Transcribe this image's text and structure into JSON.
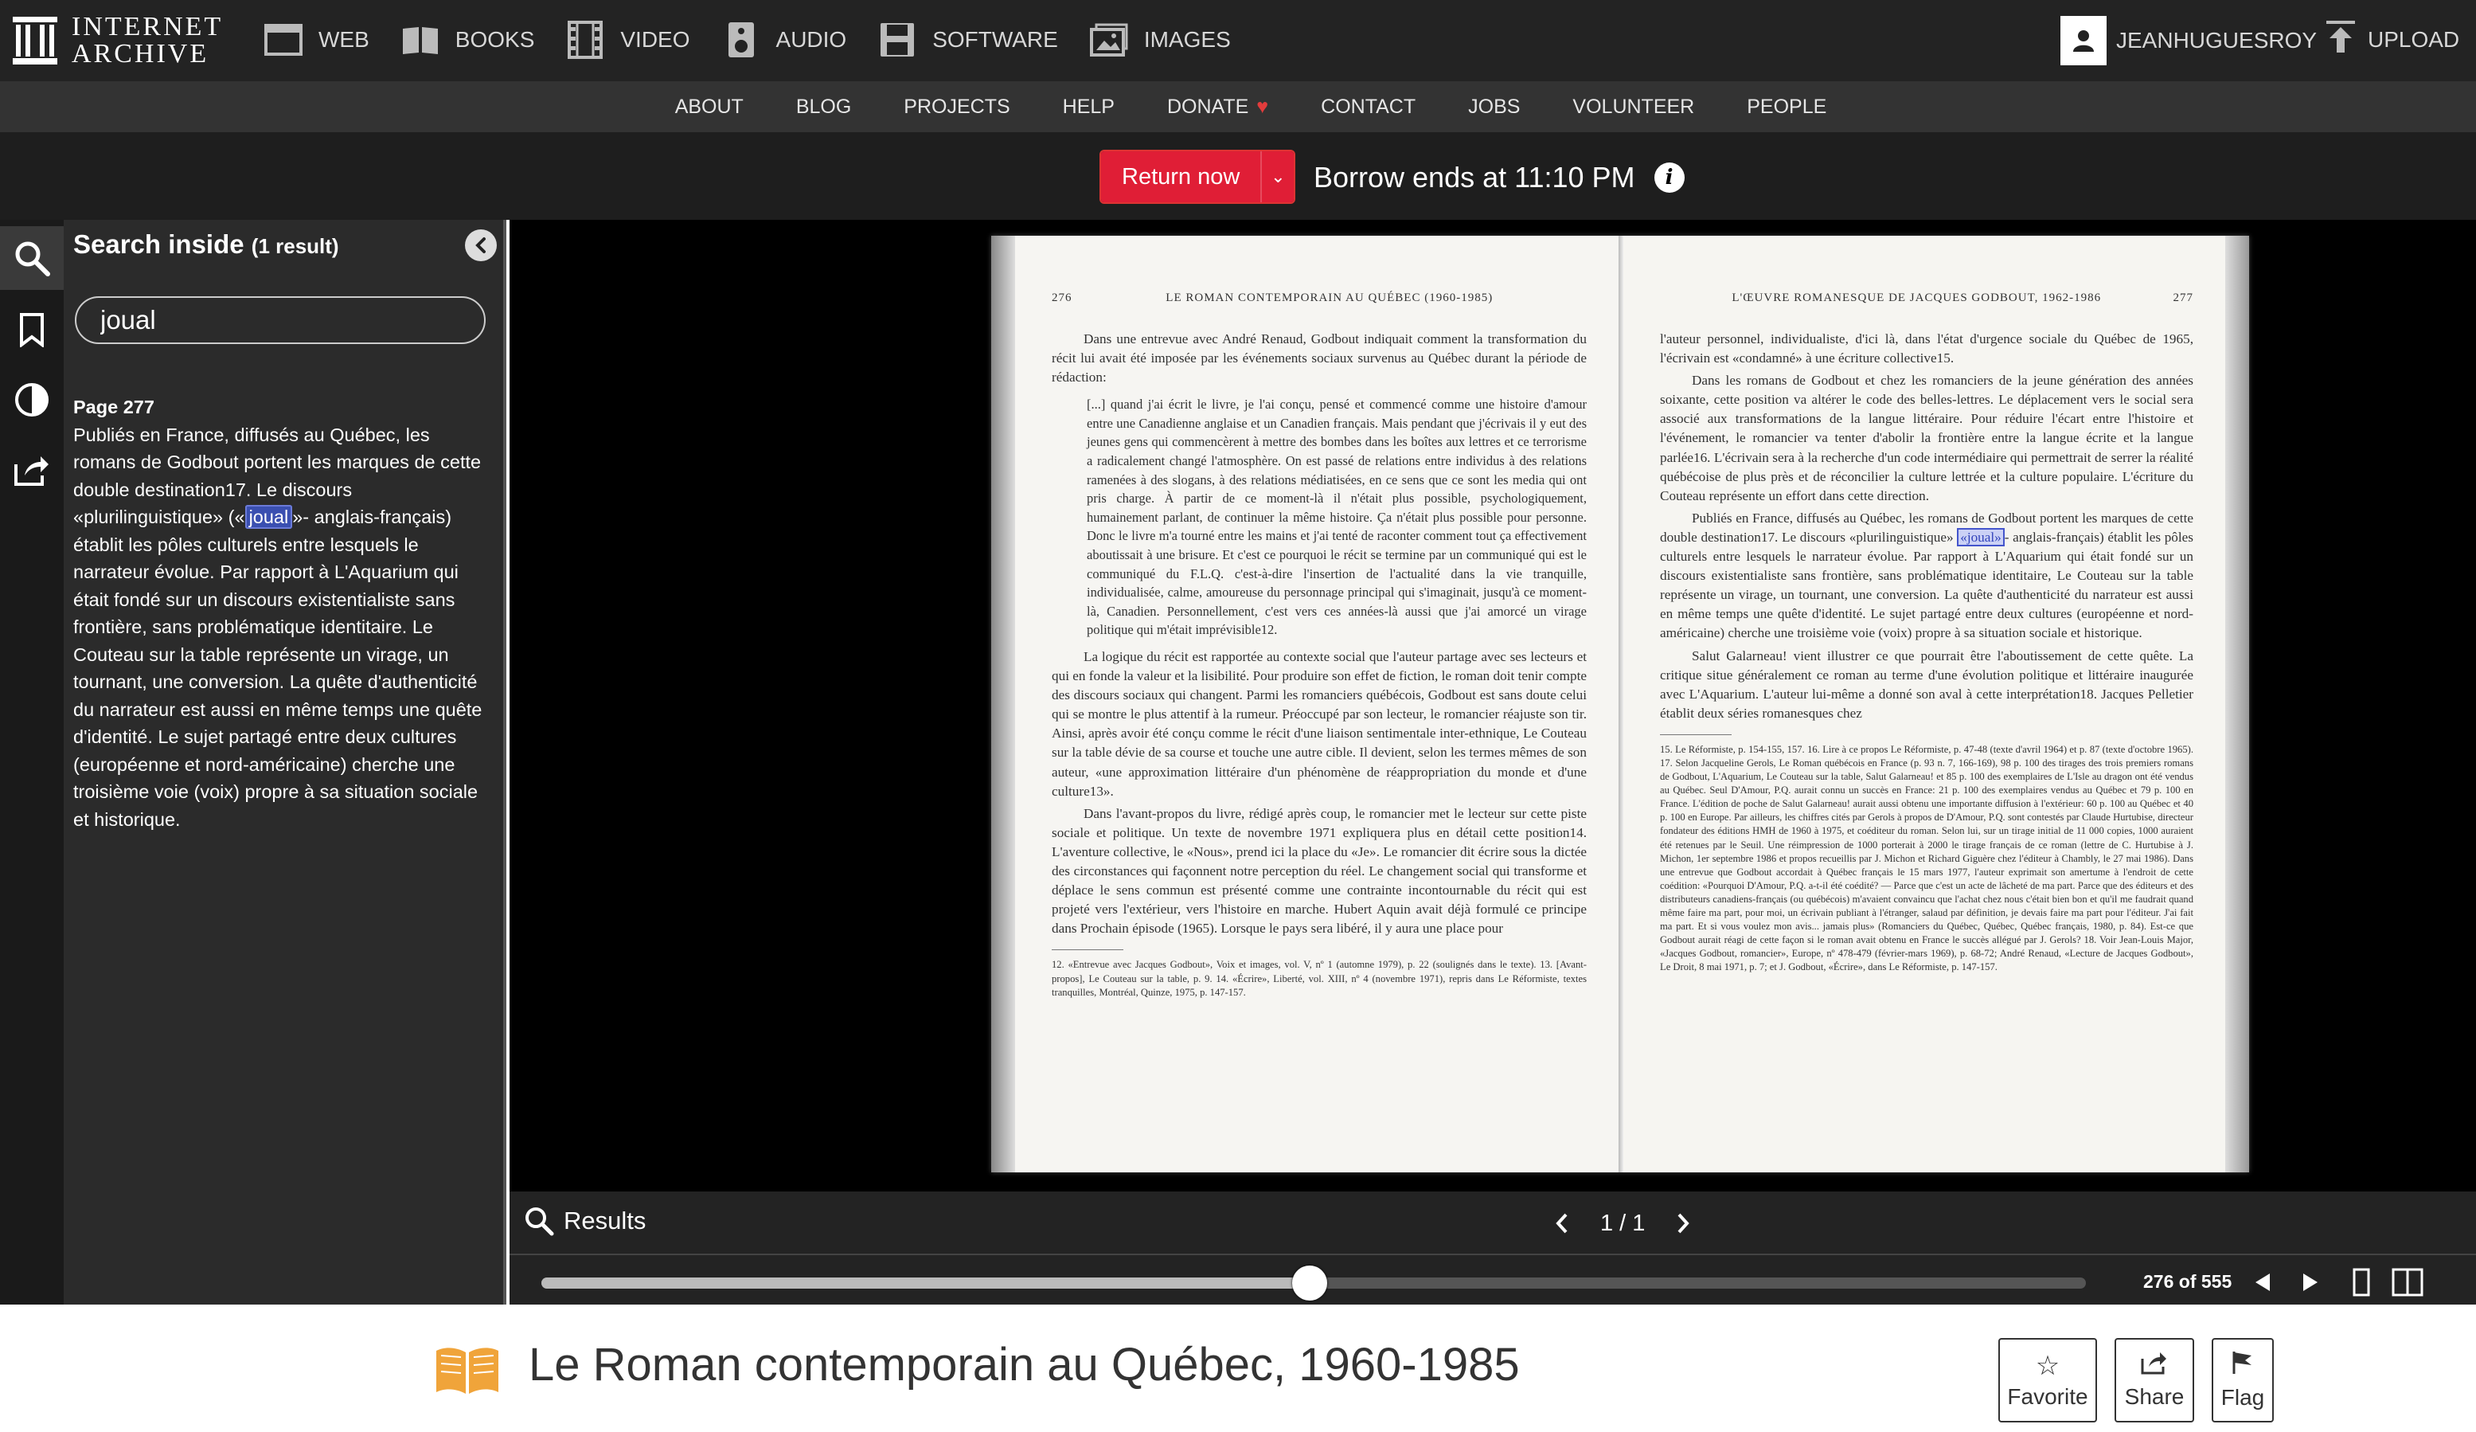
{
  "brand": {
    "line1": "INTERNET",
    "line2": "ARCHIVE"
  },
  "media_nav": [
    {
      "label": "WEB",
      "icon": "web-icon"
    },
    {
      "label": "BOOKS",
      "icon": "books-icon"
    },
    {
      "label": "VIDEO",
      "icon": "video-icon"
    },
    {
      "label": "AUDIO",
      "icon": "audio-icon"
    },
    {
      "label": "SOFTWARE",
      "icon": "software-icon"
    },
    {
      "label": "IMAGES",
      "icon": "images-icon"
    }
  ],
  "user": {
    "name": "JEANHUGUESROY"
  },
  "upload": {
    "label": "UPLOAD"
  },
  "subnav": [
    "ABOUT",
    "BLOG",
    "PROJECTS",
    "HELP",
    "DONATE",
    "CONTACT",
    "JOBS",
    "VOLUNTEER",
    "PEOPLE"
  ],
  "borrow": {
    "return_label": "Return now",
    "borrow_text": "Borrow ends at 11:10 PM",
    "info": "i"
  },
  "search": {
    "title": "Search inside",
    "count": "(1 result)",
    "query": "joual",
    "result_page": "Page 277",
    "result_before": "Publiés en France, diffusés au Québec, les romans de Godbout portent les marques de cette double destination17. Le discours «plurilinguistique» («",
    "result_hit": "joual",
    "result_after": "»- anglais-français) établit les pôles culturels entre lesquels le narrateur évolue. Par rapport à L'Aquarium qui était fondé sur un discours existentialiste sans frontière, sans problématique identitaire. Le Couteau sur la table représente un virage, un tournant, une conversion. La quête d'authenticité du narrateur est aussi en même temps une quête d'identité. Le sujet partagé entre deux cultures (européenne et nord-américaine) cherche une troisième voie (voix) propre à sa situation sociale et historique."
  },
  "book": {
    "left": {
      "number": "276",
      "header": "LE ROMAN CONTEMPORAIN AU QUÉBEC (1960-1985)",
      "p1": "Dans une entrevue avec André Renaud, Godbout indiquait comment la transformation du récit lui avait été imposée par les événements sociaux survenus au Québec durant la période de rédaction:",
      "quote": "[...] quand j'ai écrit le livre, je l'ai conçu, pensé et commencé comme une histoire d'amour entre une Canadienne anglaise et un Canadien français. Mais pendant que j'écrivais il y eut des jeunes gens qui commencèrent à mettre des bombes dans les boîtes aux lettres et ce terrorisme a radicalement changé l'atmosphère. On est passé de relations entre individus à des relations ramenées à des slogans, à des relations médiatisées, en ce sens que ce sont les media qui ont pris charge. À partir de ce moment-là il n'était plus possible, psychologiquement, humainement parlant, de continuer la même histoire. Ça n'était plus possible pour personne. Donc le livre m'a tourné entre les mains et j'ai tenté de raconter comment tout ça effectivement aboutissait à une brisure. Et c'est ce pourquoi le récit se termine par un communiqué qui est le communiqué du F.L.Q. c'est-à-dire l'insertion de l'actualité dans la vie tranquille, individualisée, calme, amoureuse du personnage principal qui s'imaginait, jusqu'à ce moment-là, Canadien. Personnellement, c'est vers ces années-là aussi que j'ai amorcé un virage politique qui m'était imprévisible12.",
      "p2": "La logique du récit est rapportée au contexte social que l'auteur partage avec ses lecteurs et qui en fonde la valeur et la lisibilité. Pour produire son effet de fiction, le roman doit tenir compte des discours sociaux qui changent. Parmi les romanciers québécois, Godbout est sans doute celui qui se montre le plus attentif à la rumeur. Préoccupé par son lecteur, le romancier réajuste son tir. Ainsi, après avoir été conçu comme le récit d'une liaison sentimentale inter-ethnique, Le Couteau sur la table dévie de sa course et touche une autre cible. Il devient, selon les termes mêmes de son auteur, «une approximation littéraire d'un phénomène de réappropriation du monde et d'une culture13».",
      "p3": "Dans l'avant-propos du livre, rédigé après coup, le romancier met le lecteur sur cette piste sociale et politique. Un texte de novembre 1971 expliquera plus en détail cette position14. L'aventure collective, le «Nous», prend ici la place du «Je». Le romancier dit écrire sous la dictée des circonstances qui façonnent notre perception du réel. Le changement social qui transforme et déplace le sens commun est présenté comme une contrainte incontournable du récit qui est projeté vers l'extérieur, vers l'histoire en marche. Hubert Aquin avait déjà formulé ce principe dans Prochain épisode (1965). Lorsque le pays sera libéré, il y aura une place pour",
      "notes": "12. «Entrevue avec Jacques Godbout», Voix et images, vol. V, nº 1 (automne 1979), p. 22 (soulignés dans le texte). 13. [Avant-propos], Le Couteau sur la table, p. 9. 14. «Écrire», Liberté, vol. XIII, nº 4 (novembre 1971), repris dans Le Réformiste, textes tranquilles, Montréal, Quinze, 1975, p. 147-157."
    },
    "right": {
      "number": "277",
      "header": "L'ŒUVRE ROMANESQUE DE JACQUES GODBOUT, 1962-1986",
      "p1": "l'auteur personnel, individualiste, d'ici là, dans l'état d'urgence sociale du Québec de 1965, l'écrivain est «condamné» à une écriture collective15.",
      "p2": "Dans les romans de Godbout et chez les romanciers de la jeune génération des années soixante, cette position va altérer le code des belles-lettres. Le déplacement vers le social sera associé aux transformations de la langue littéraire. Pour réduire l'écart entre l'histoire et l'événement, le romancier va tenter d'abolir la frontière entre la langue écrite et la langue parlée16. L'écrivain sera à la recherche d'un code intermédiaire qui permettrait de serrer la réalité québécoise de plus près et de réconcilier la culture lettrée et la culture populaire. L'écriture du Couteau représente un effort dans cette direction.",
      "p3_before": "Publiés en France, diffusés au Québec, les romans de Godbout portent les marques de cette double destination17. Le discours «plurilinguistique» ",
      "p3_hit": "«joual»",
      "p3_after": "- anglais-français) établit les pôles culturels entre lesquels le narrateur évolue. Par rapport à L'Aquarium qui était fondé sur un discours existentialiste sans frontière, sans problématique identitaire, Le Couteau sur la table représente un virage, un tournant, une conversion. La quête d'authenticité du narrateur est aussi en même temps une quête d'identité. Le sujet partagé entre deux cultures (européenne et nord-américaine) cherche une troisième voie (voix) propre à sa situation sociale et historique.",
      "p4": "Salut Galarneau! vient illustrer ce que pourrait être l'aboutissement de cette quête. La critique situe généralement ce roman au terme d'une évolution politique et littéraire inaugurée avec L'Aquarium. L'auteur lui-même a donné son aval à cette interprétation18. Jacques Pelletier établit deux séries romanesques chez",
      "notes": "15. Le Réformiste, p. 154-155, 157. 16. Lire à ce propos Le Réformiste, p. 47-48 (texte d'avril 1964) et p. 87 (texte d'octobre 1965). 17. Selon Jacqueline Gerols, Le Roman québécois en France (p. 93 n. 7, 166-169), 98 p. 100 des tirages des trois premiers romans de Godbout, L'Aquarium, Le Couteau sur la table, Salut Galarneau! et 85 p. 100 des exemplaires de L'Isle au dragon ont été vendus au Québec. Seul D'Amour, P.Q. aurait connu un succès en France: 21 p. 100 des exemplaires vendus au Québec et 79 p. 100 en France. L'édition de poche de Salut Galarneau! aurait aussi obtenu une importante diffusion à l'extérieur: 60 p. 100 au Québec et 40 p. 100 en Europe. Par ailleurs, les chiffres cités par Gerols à propos de D'Amour, P.Q. sont contestés par Claude Hurtubise, directeur fondateur des éditions HMH de 1960 à 1975, et coéditeur du roman. Selon lui, sur un tirage initial de 11 000 copies, 1000 auraient été retenues par le Seuil. Une réimpression de 1000 porterait à 2000 le tirage français de ce roman (lettre de C. Hurtubise à J. Michon, 1er septembre 1986 et propos recueillis par J. Michon et Richard Giguère chez l'éditeur à Chambly, le 27 mai 1986). Dans une entrevue que Godbout accordait à Québec français le 15 mars 1977, l'auteur exprimait son amertume à l'endroit de cette coédition: «Pourquoi D'Amour, P.Q. a-t-il été coédité? — Parce que c'est un acte de lâcheté de ma part. Parce que des éditeurs et des distributeurs canadiens-français (ou québécois) m'avaient convaincu que l'achat chez nous c'était bien bon et qu'il me faudrait quand même faire ma part, pour moi, un écrivain publiant à l'étranger, salaud par définition, je devais faire ma part pour l'éditeur. J'ai fait ma part. Et si vous voulez mon avis... jamais plus» (Romanciers du Québec, Québec, Québec français, 1980, p. 84). Est-ce que Godbout aurait réagi de cette façon si le roman avait obtenu en France le succès allégué par J. Gerols? 18. Voir Jean-Louis Major, «Jacques Godbout, romancier», Europe, nº 478-479 (février-mars 1969), p. 68-72; André Renaud, «Lecture de Jacques Godbout», Le Droit, 8 mai 1971, p. 7; et J. Godbout, «Écrire», dans Le Réformiste, p. 147-157."
    }
  },
  "controls": {
    "results_label": "Results",
    "pager": "1 / 1",
    "page_count": "276 of 555",
    "current_page": 276,
    "total_pages": 555,
    "hit_page": 277
  },
  "title": {
    "text": "Le Roman contemporain au Québec, 1960-1985",
    "favorite": "Favorite",
    "share": "Share",
    "flag": "Flag"
  },
  "colors": {
    "return_red": "#e01e36",
    "highlight": "#3a4fb0",
    "heart": "#e23c3c",
    "book_icon": "#f0a43a"
  }
}
